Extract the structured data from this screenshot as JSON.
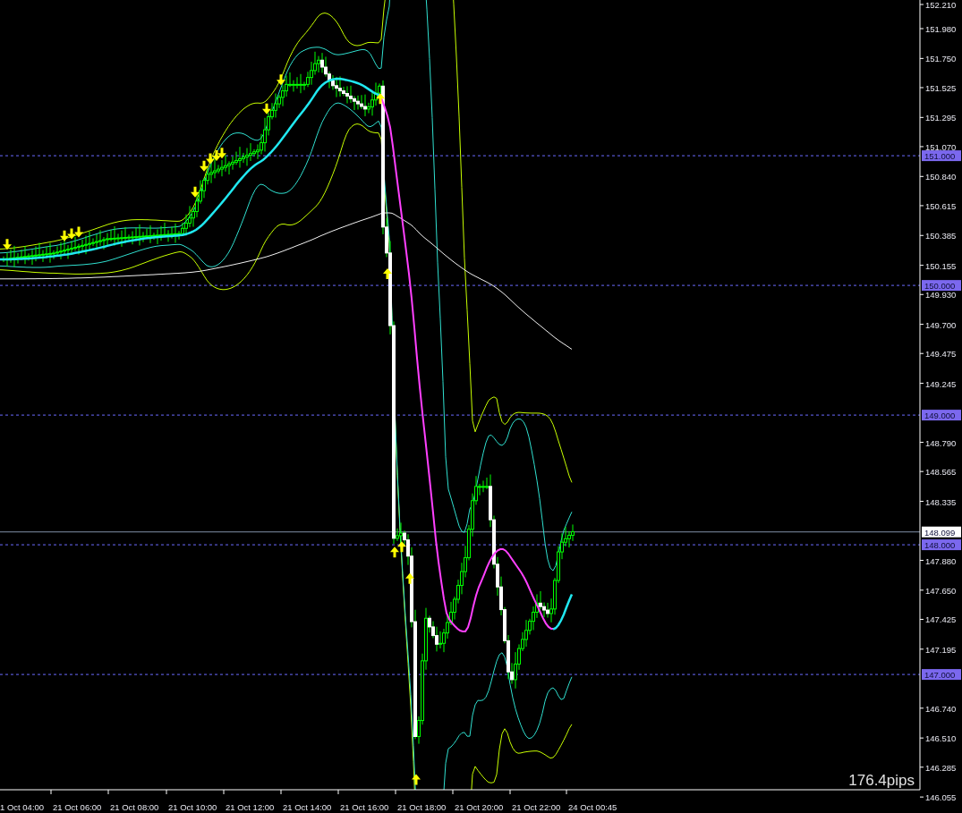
{
  "chart": {
    "price_axis": {
      "labels": [
        "152.210",
        "151.980",
        "151.750",
        "151.525",
        "151.295",
        "151.070",
        "150.840",
        "150.615",
        "150.385",
        "150.155",
        "149.930",
        "149.700",
        "149.475",
        "149.245",
        "148.790",
        "148.565",
        "148.335",
        "147.880",
        "147.650",
        "147.425",
        "147.195",
        "146.740",
        "146.510",
        "146.285",
        "146.055"
      ]
    },
    "level_lines": [
      {
        "label": "151.000",
        "kind": "level"
      },
      {
        "label": "150.000",
        "kind": "level"
      },
      {
        "label": "149.000",
        "kind": "level"
      },
      {
        "label": "148.099",
        "kind": "bid"
      },
      {
        "label": "148.000",
        "kind": "level"
      },
      {
        "label": "147.000",
        "kind": "level"
      }
    ],
    "time_axis": {
      "labels": [
        "1 Oct 04:00",
        "21 Oct 06:00",
        "21 Oct 08:00",
        "21 Oct 10:00",
        "21 Oct 12:00",
        "21 Oct 14:00",
        "21 Oct 16:00",
        "21 Oct 18:00",
        "21 Oct 20:00",
        "21 Oct 22:00",
        "24 Oct 00:45"
      ]
    },
    "range_readout": "176.4pips"
  }
}
